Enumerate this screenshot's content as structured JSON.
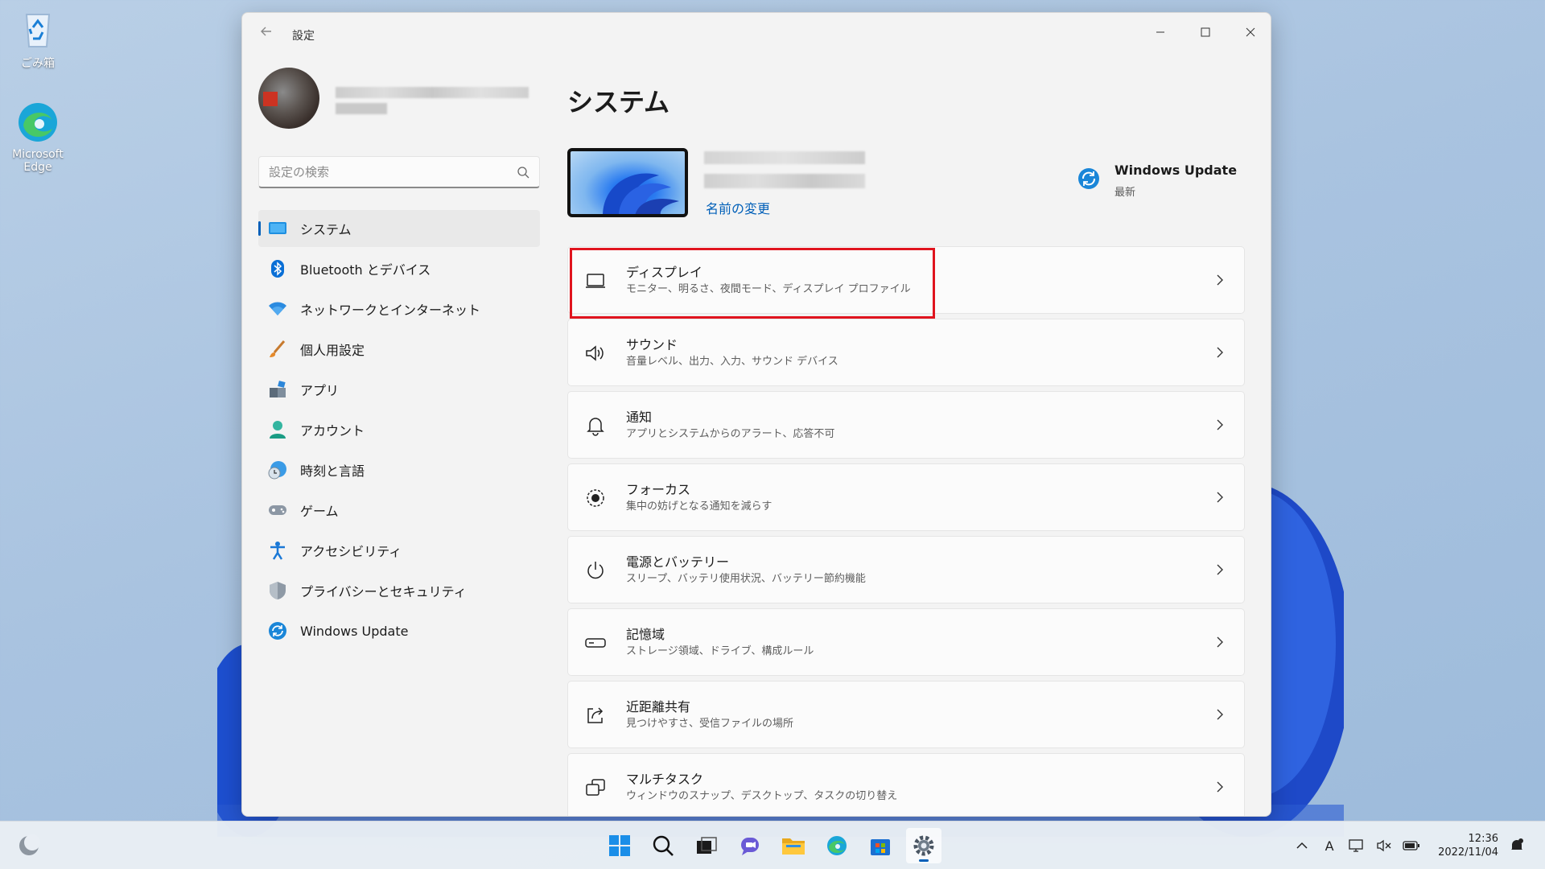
{
  "desktop": {
    "recycle_bin_label": "ごみ箱",
    "edge_label_line1": "Microsoft",
    "edge_label_line2": "Edge"
  },
  "window": {
    "title": "設定",
    "search_placeholder": "設定の検索",
    "nav": [
      {
        "label": "システム",
        "icon": "system-icon",
        "active": true
      },
      {
        "label": "Bluetooth とデバイス",
        "icon": "bluetooth-icon"
      },
      {
        "label": "ネットワークとインターネット",
        "icon": "wifi-icon"
      },
      {
        "label": "個人用設定",
        "icon": "brush-icon"
      },
      {
        "label": "アプリ",
        "icon": "apps-icon"
      },
      {
        "label": "アカウント",
        "icon": "account-icon"
      },
      {
        "label": "時刻と言語",
        "icon": "globe-clock-icon"
      },
      {
        "label": "ゲーム",
        "icon": "gamepad-icon"
      },
      {
        "label": "アクセシビリティ",
        "icon": "accessibility-icon"
      },
      {
        "label": "プライバシーとセキュリティ",
        "icon": "shield-icon"
      },
      {
        "label": "Windows Update",
        "icon": "windows-update-icon"
      }
    ]
  },
  "main": {
    "title": "システム",
    "rename_link": "名前の変更",
    "windows_update": {
      "title": "Windows Update",
      "status": "最新"
    },
    "cards": [
      {
        "title": "ディスプレイ",
        "subtitle": "モニター、明るさ、夜間モード、ディスプレイ プロファイル",
        "icon": "display-icon"
      },
      {
        "title": "サウンド",
        "subtitle": "音量レベル、出力、入力、サウンド デバイス",
        "icon": "speaker-icon"
      },
      {
        "title": "通知",
        "subtitle": "アプリとシステムからのアラート、応答不可",
        "icon": "bell-icon"
      },
      {
        "title": "フォーカス",
        "subtitle": "集中の妨げとなる通知を減らす",
        "icon": "focus-icon"
      },
      {
        "title": "電源とバッテリー",
        "subtitle": "スリープ、バッテリ使用状況、バッテリー節約機能",
        "icon": "power-icon"
      },
      {
        "title": "記憶域",
        "subtitle": "ストレージ領域、ドライブ、構成ルール",
        "icon": "storage-icon"
      },
      {
        "title": "近距離共有",
        "subtitle": "見つけやすさ、受信ファイルの場所",
        "icon": "share-icon"
      },
      {
        "title": "マルチタスク",
        "subtitle": "ウィンドウのスナップ、デスクトップ、タスクの切り替え",
        "icon": "multitask-icon"
      }
    ]
  },
  "taskbar": {
    "ime_indicator": "A",
    "time": "12:36",
    "date": "2022/11/04"
  },
  "colors": {
    "accent": "#005fb8",
    "highlight_border": "#e0141e",
    "window_bg": "#f3f3f3"
  }
}
